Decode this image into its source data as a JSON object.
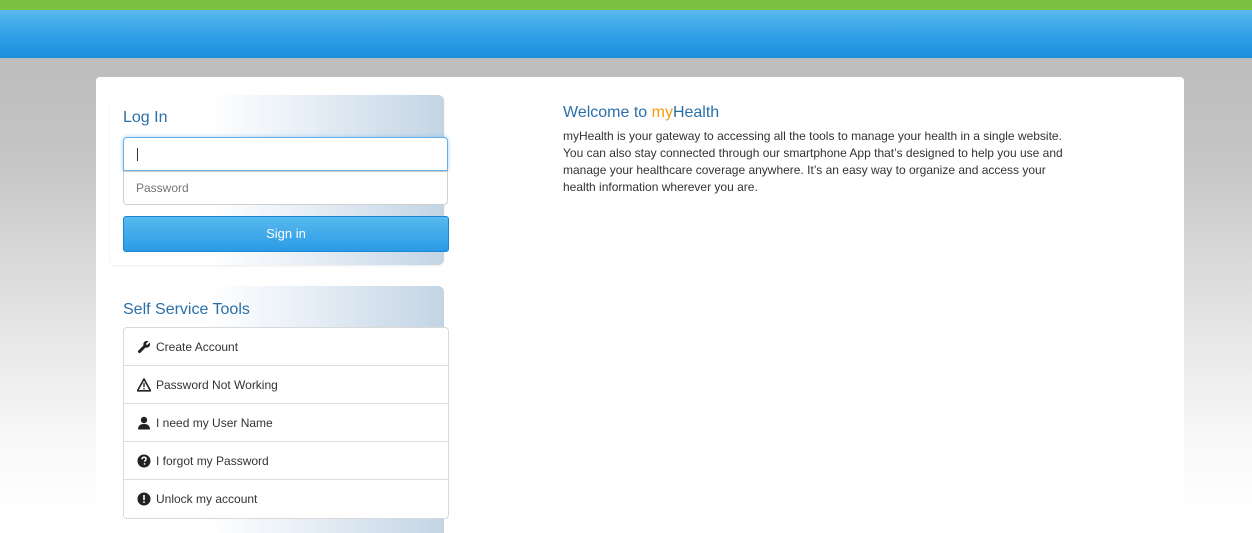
{
  "login": {
    "title": "Log In",
    "username_value": "",
    "password_placeholder": "Password",
    "signin_label": "Sign in"
  },
  "tools": {
    "title": "Self Service Tools",
    "items": [
      {
        "label": "Create Account",
        "icon": "wrench-icon"
      },
      {
        "label": "Password Not Working",
        "icon": "warning-icon"
      },
      {
        "label": "I need my User Name",
        "icon": "user-icon"
      },
      {
        "label": "I forgot my Password",
        "icon": "question-circle-icon"
      },
      {
        "label": "Unlock my account",
        "icon": "exclamation-circle-icon"
      }
    ]
  },
  "welcome": {
    "title_prefix": "Welcome to ",
    "brand_my": "my",
    "brand_health": "Health",
    "body": "myHealth is your gateway to accessing all the tools to manage your health in a single website. You can also stay connected through our smartphone App that’s designed to help you use and manage your healthcare coverage anywhere. It’s an easy way to organize and access your health information wherever you are."
  },
  "colors": {
    "accent_green": "#7cc242",
    "header_blue": "#2c9ee6",
    "title_blue": "#2a6fa8",
    "brand_orange": "#f39c12"
  }
}
